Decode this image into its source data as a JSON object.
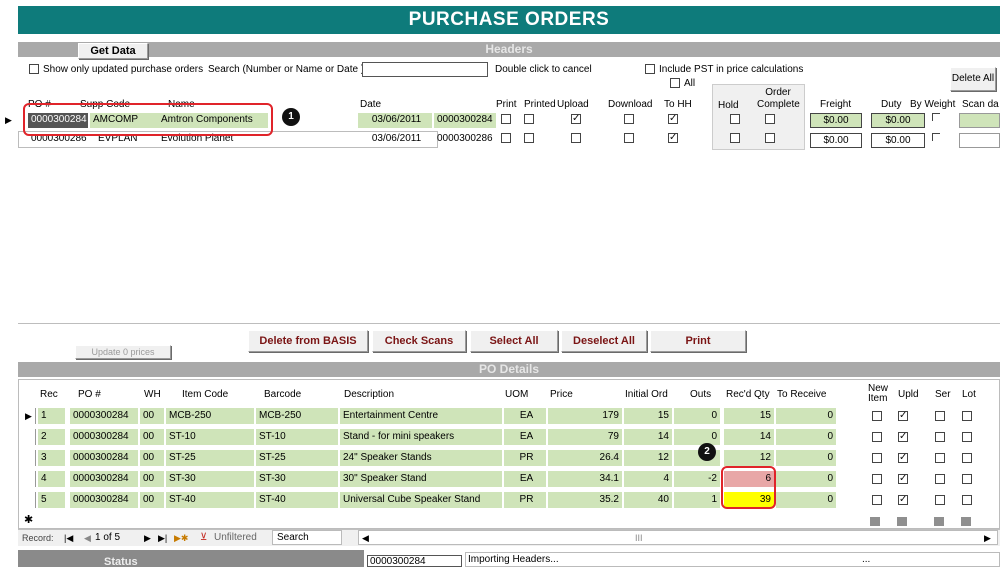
{
  "title": "PURCHASE ORDERS",
  "headers_section": {
    "title": "Headers",
    "get_data_label": "Get Data",
    "show_updated_label": "Show only updated purchase orders",
    "search_label": "Search (Number or Name or Date )",
    "search_value": "",
    "double_click_label": "Double click to cancel",
    "include_pst_label": "Include PST in price calculations",
    "all_label": "All",
    "delete_all_label": "Delete All",
    "columns": {
      "po": "PO #",
      "supp_code": "Supp Code",
      "name": "Name",
      "date": "Date",
      "print": "Print",
      "printed": "Printed",
      "upload": "Upload",
      "download": "Download",
      "to_hh": "To HH",
      "hold": "Hold",
      "order_complete": "Order Complete",
      "freight": "Freight",
      "duty": "Duty",
      "by_weight": "By Weight",
      "scan_date": "Scan da"
    },
    "rows": [
      {
        "po": "0000300284",
        "supp": "AMCOMP",
        "name": "Amtron Components",
        "date": "03/06/2011",
        "po2": "0000300284",
        "print": false,
        "printed": false,
        "upload": true,
        "download": false,
        "to_hh": true,
        "hold": false,
        "complete": false,
        "freight": "$0.00",
        "duty": "$0.00"
      },
      {
        "po": "0000300286",
        "supp": "EVPLAN",
        "name": "Evolution Planet",
        "date": "03/06/2011",
        "po2": "0000300286",
        "print": false,
        "printed": false,
        "upload": false,
        "download": false,
        "to_hh": true,
        "hold": false,
        "complete": false,
        "freight": "$0.00",
        "duty": "$0.00"
      }
    ]
  },
  "callouts": {
    "one": "1",
    "two": "2"
  },
  "actions": {
    "update_prices": "Update 0 prices",
    "delete_from_basis": "Delete from BASIS",
    "check_scans": "Check Scans",
    "select_all": "Select All",
    "deselect_all": "Deselect All",
    "print": "Print"
  },
  "details_section": {
    "title": "PO Details",
    "columns": {
      "rec": "Rec",
      "po": "PO #",
      "wh": "WH",
      "item_code": "Item Code",
      "barcode": "Barcode",
      "description": "Description",
      "uom": "UOM",
      "price": "Price",
      "initial_ord": "Initial Ord",
      "outs": "Outs",
      "recd_qty": "Rec'd Qty",
      "to_receive": "To Receive",
      "new_item": "New Item",
      "upld": "Upld",
      "ser": "Ser",
      "lot": "Lot"
    },
    "rows": [
      {
        "rec": "1",
        "po": "0000300284",
        "wh": "00",
        "item": "MCB-250",
        "barcode": "MCB-250",
        "desc": "Entertainment Centre",
        "uom": "EA",
        "price": "179",
        "initial": "15",
        "outs": "0",
        "recd": "15",
        "to_receive": "0",
        "new_item": false,
        "upld": true,
        "ser": false,
        "lot": false
      },
      {
        "rec": "2",
        "po": "0000300284",
        "wh": "00",
        "item": "ST-10",
        "barcode": "ST-10",
        "desc": "Stand - for mini speakers",
        "uom": "EA",
        "price": "79",
        "initial": "14",
        "outs": "0",
        "recd": "14",
        "to_receive": "0",
        "new_item": false,
        "upld": true,
        "ser": false,
        "lot": false
      },
      {
        "rec": "3",
        "po": "0000300284",
        "wh": "00",
        "item": "ST-25",
        "barcode": "ST-25",
        "desc": "24\" Speaker Stands",
        "uom": "PR",
        "price": "26.4",
        "initial": "12",
        "outs": "",
        "recd": "12",
        "to_receive": "0",
        "new_item": false,
        "upld": true,
        "ser": false,
        "lot": false
      },
      {
        "rec": "4",
        "po": "0000300284",
        "wh": "00",
        "item": "ST-30",
        "barcode": "ST-30",
        "desc": "30\" Speaker Stand",
        "uom": "EA",
        "price": "34.1",
        "initial": "4",
        "outs": "-2",
        "recd": "6",
        "to_receive": "0",
        "new_item": false,
        "upld": true,
        "ser": false,
        "lot": false
      },
      {
        "rec": "5",
        "po": "0000300284",
        "wh": "00",
        "item": "ST-40",
        "barcode": "ST-40",
        "desc": "Universal Cube Speaker Stand",
        "uom": "PR",
        "price": "35.2",
        "initial": "40",
        "outs": "1",
        "recd": "39",
        "to_receive": "0",
        "new_item": false,
        "upld": true,
        "ser": false,
        "lot": false
      }
    ],
    "new_row_marker": "✱"
  },
  "navigator": {
    "record_label": "Record:",
    "position": "1 of 5",
    "filter_label": "Unfiltered",
    "search_label": "Search"
  },
  "status_bar": {
    "status_label": "Status",
    "po_value": "0000300284",
    "message": "Importing Headers...",
    "ellipsis": "..."
  },
  "colors": {
    "title_bar": "#0e7b7b",
    "field_green": "#cfe4b9",
    "highlight_pink": "#e8a7a7",
    "highlight_yellow": "#ffff00",
    "callout_border": "#e0242a"
  }
}
